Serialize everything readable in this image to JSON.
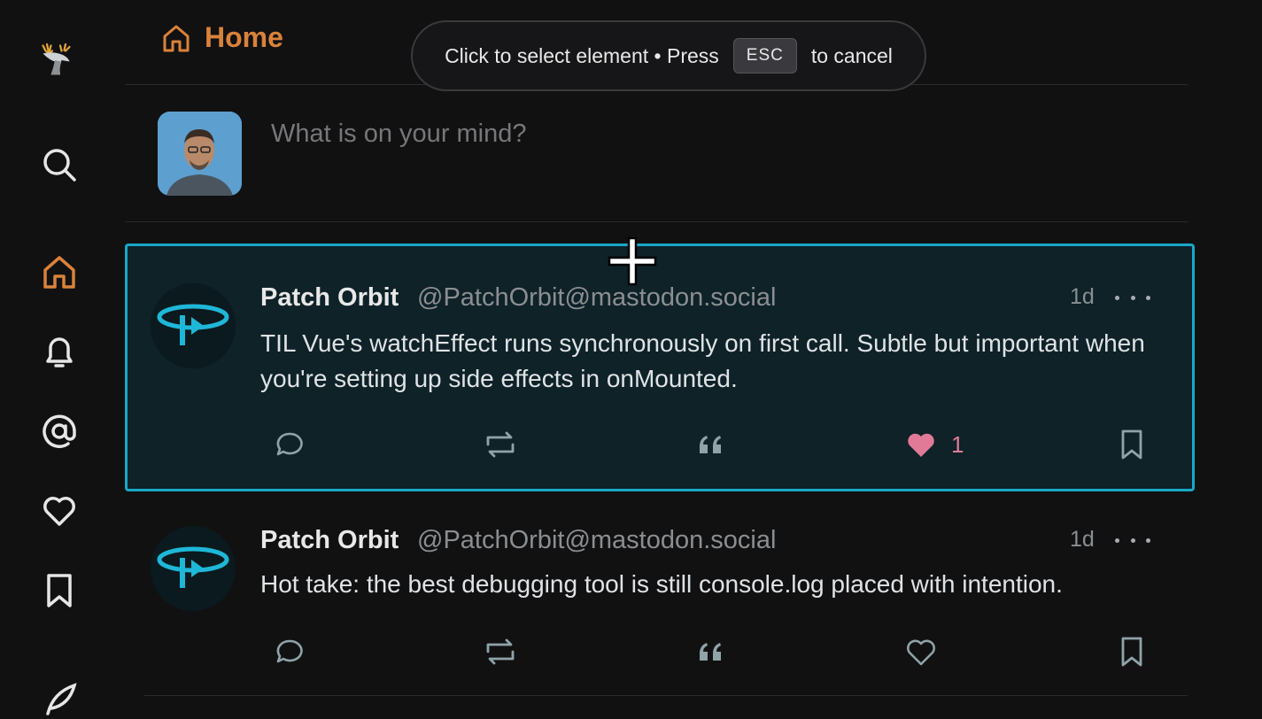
{
  "header": {
    "title": "Home"
  },
  "composer": {
    "placeholder": "What is on your mind?"
  },
  "toast": {
    "text_before": "Click to select element • Press",
    "key": "ESC",
    "text_after": "to cancel"
  },
  "sidebar": {
    "items": [
      {
        "icon": "deer-logo-icon"
      },
      {
        "icon": "search-icon"
      },
      {
        "icon": "home-icon",
        "active": true
      },
      {
        "icon": "bell-icon"
      },
      {
        "icon": "at-icon"
      },
      {
        "icon": "heart-icon"
      },
      {
        "icon": "bookmark-icon"
      },
      {
        "icon": "feather-icon"
      }
    ]
  },
  "posts": [
    {
      "author": "Patch Orbit",
      "handle": "@PatchOrbit@mastodon.social",
      "time": "1d",
      "text": "TIL Vue's watchEffect runs synchronously on first call. Subtle but important when you're setting up side effects in onMounted.",
      "likes": "1",
      "liked": true,
      "selected": true
    },
    {
      "author": "Patch Orbit",
      "handle": "@PatchOrbit@mastodon.social",
      "time": "1d",
      "text": "Hot take: the best debugging tool is still console.log placed with intention.",
      "likes": "",
      "liked": false,
      "selected": false
    }
  ],
  "colors": {
    "accent": "#d9823a",
    "selection": "#18a8c9",
    "liked": "#e07a97",
    "background": "#111112"
  }
}
